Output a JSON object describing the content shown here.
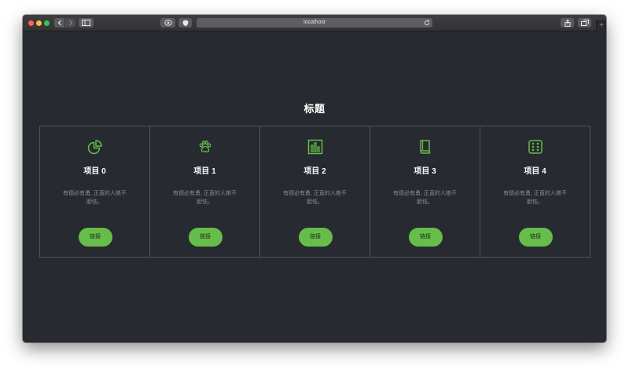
{
  "browser": {
    "url": "localhost"
  },
  "page": {
    "title": "标题",
    "accent_color": "#67bd49",
    "background_color": "#272a31"
  },
  "cards": [
    {
      "icon": "pie-chart-icon",
      "title": "项目 0",
      "description": "有德必有勇, 正直的人绝不胆怯。",
      "link_label": "链接"
    },
    {
      "icon": "paw-icon",
      "title": "项目 1",
      "description": "有德必有勇, 正直的人绝不胆怯。",
      "link_label": "链接"
    },
    {
      "icon": "bar-chart-icon",
      "title": "项目 2",
      "description": "有德必有勇, 正直的人绝不胆怯。",
      "link_label": "链接"
    },
    {
      "icon": "book-icon",
      "title": "项目 3",
      "description": "有德必有勇, 正直的人绝不胆怯。",
      "link_label": "链接"
    },
    {
      "icon": "dice-icon",
      "title": "项目 4",
      "description": "有德必有勇, 正直的人绝不胆怯。",
      "link_label": "链接"
    }
  ]
}
